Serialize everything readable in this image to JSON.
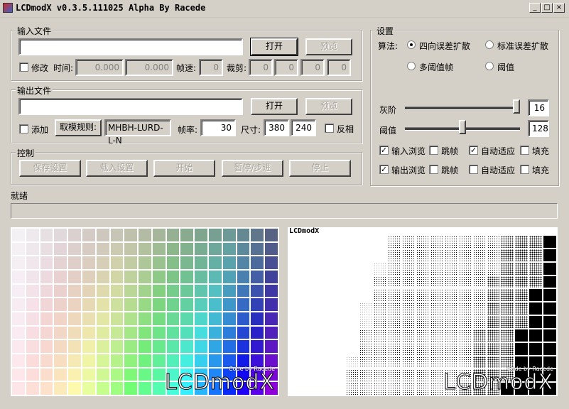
{
  "window": {
    "title": "LCDmodX v0.3.5.111025 Alpha By Racede",
    "min": "_",
    "max": "□",
    "close": "×"
  },
  "input_group": {
    "title": "输入文件",
    "path": "",
    "open": "打开",
    "preview": "预览",
    "modify_label": "修改",
    "time_label": "时间:",
    "time_start": "0.000",
    "time_end": "0.000",
    "fps_label": "帧速:",
    "fps": "0",
    "crop_label": "裁剪:",
    "crop": [
      "0",
      "0",
      "0",
      "0"
    ]
  },
  "output_group": {
    "title": "输出文件",
    "path": "",
    "open": "打开",
    "preview": "预览",
    "append_label": "添加",
    "rule_button": "取模规则:",
    "rule_value": "MHBH-LURD-L-N",
    "rate_label": "帧率:",
    "rate": "30",
    "size_label": "尺寸:",
    "width": "380",
    "height": "240",
    "invert_label": "反相"
  },
  "control_group": {
    "title": "控制",
    "save": "保存设置",
    "load": "载入设置",
    "start": "开始",
    "pause": "暂停/步进",
    "stop": "停止"
  },
  "settings": {
    "title": "设置",
    "algo_label": "算法:",
    "radios": [
      "四向误差扩散",
      "标准误差扩散",
      "多阈值帧",
      "阈值"
    ],
    "selected_algo": "四向误差扩散",
    "gray_label": "灰阶",
    "gray_value": "16",
    "gray_level": 1.0,
    "threshold_label": "阈值",
    "threshold_value": "128",
    "threshold_level": 0.5,
    "row1": [
      "输入浏览",
      "跳帧",
      "自动适应",
      "填充"
    ],
    "row1_checked": [
      true,
      false,
      true,
      false
    ],
    "row2": [
      "输出浏览",
      "跳帧",
      "自动适应",
      "填充"
    ],
    "row2_checked": [
      true,
      false,
      false,
      false
    ]
  },
  "status": {
    "text": "就绪"
  },
  "previews": {
    "dither_tag": "LCDmodX",
    "brand_sub": "Code by Racede",
    "brand_main": "LCDmodX"
  }
}
